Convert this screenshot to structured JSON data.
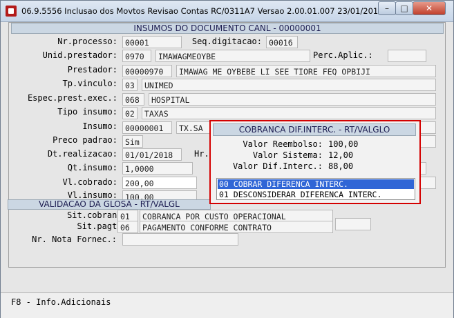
{
  "window": {
    "title": "06.9.5556  Inclusao  dos Movtos Revisao Contas RC/0311A7 Versao 2.00.01.007 23/01/2018 - 1...",
    "min_label": "–",
    "max_label": "□",
    "close_label": "✕"
  },
  "section": {
    "header": "INSUMOS DO DOCUMENTO CANL - 00000001"
  },
  "form": {
    "nr_processo": {
      "label": "Nr.processo:",
      "value": "00001"
    },
    "seq_digitacao": {
      "label": "Seq.digitacao:",
      "value": "00016"
    },
    "unid_prestador": {
      "label": "Unid.prestador:",
      "code": "0970",
      "name": "IMAWAGMEOYBE"
    },
    "perc_aplic": {
      "label": "Perc.Aplic.:",
      "value": ""
    },
    "prestador": {
      "label": "Prestador:",
      "code": "00000970",
      "name": "IMAWAG ME OYBEBE LI SEE TIORE FEQ OPBIJI"
    },
    "tp_vinculo": {
      "label": "Tp.vinculo:",
      "code": "03",
      "name": "UNIMED"
    },
    "espec_prest_exec": {
      "label": "Espec.prest.exec.:",
      "code": "068",
      "name": "HOSPITAL"
    },
    "tipo_insumo": {
      "label": "Tipo insumo:",
      "code": "02",
      "name": "TAXAS"
    },
    "insumo": {
      "label": "Insumo:",
      "code": "00000001",
      "name": "TX.SA"
    },
    "preco_padrao": {
      "label": "Preco padrao:",
      "value": "Sim"
    },
    "dt_realizacao": {
      "label": "Dt.realizacao:",
      "value": "01/01/2018",
      "hr_label": "Hr."
    },
    "qt_insumo": {
      "label": "Qt.insumo:",
      "value": "1,0000"
    },
    "vl_cobrado": {
      "label": "Vl.cobrado:",
      "value": "200,00"
    },
    "vl_insumo": {
      "label": "Vl.insumo:",
      "value": "100,00"
    }
  },
  "glosa": {
    "header": "VALIDACAO DA GLOSA - RT/VALGL",
    "sit_cobranca": {
      "label": "Sit.cobranca:",
      "code": "01",
      "desc": "COBRANCA POR CUSTO OPERACIONAL"
    },
    "sit_pagto": {
      "label": "Sit.pagto.:",
      "code": "06",
      "desc": "PAGAMENTO CONFORME CONTRATO"
    },
    "nr_nota_fornec": {
      "label": "Nr. Nota Fornec.:",
      "value": ""
    }
  },
  "popup": {
    "header": "COBRANCA DIF.INTERC. - RT/VALGLO",
    "valor_reembolso": {
      "label": "Valor Reembolso:",
      "value": "100,00"
    },
    "valor_sistema": {
      "label": "Valor Sistema:",
      "value": "12,00"
    },
    "valor_dif_interc": {
      "label": "Valor Dif.Interc.:",
      "value": "88,00"
    },
    "options": [
      {
        "label": "00 COBRAR DIFERENCA INTERC.",
        "selected": true
      },
      {
        "label": "01 DESCONSIDERAR DIFERENCA INTERC.",
        "selected": false
      }
    ],
    "border_color": "#d40000",
    "selection_color": "#3066d6"
  },
  "statusbar": {
    "hint": "F8 - Info.Adicionais"
  }
}
